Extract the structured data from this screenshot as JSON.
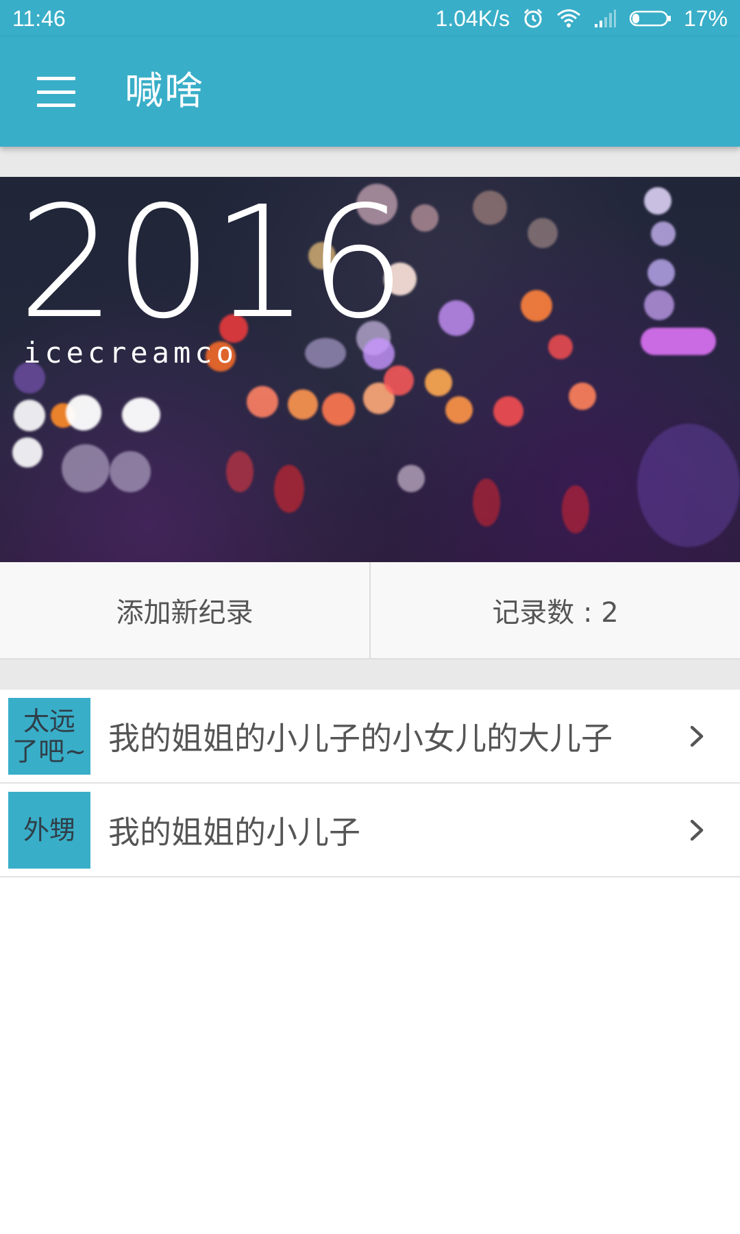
{
  "status_bar": {
    "time": "11:46",
    "net_speed": "1.04K/s",
    "battery": "17%",
    "icons": [
      "alarm-icon",
      "wifi-icon",
      "signal-icon",
      "battery-icon"
    ]
  },
  "app_bar": {
    "title": "喊啥",
    "menu_icon": "hamburger-menu-icon"
  },
  "banner": {
    "year": "2016",
    "subtitle": "icecreamco"
  },
  "actions": {
    "add_label": "添加新纪录",
    "count_label": "记录数 : 2"
  },
  "records": [
    {
      "tag": "太远了吧~",
      "text": "我的姐姐的小儿子的小女儿的大儿子"
    },
    {
      "tag": "外甥",
      "text": "我的姐姐的小儿子"
    }
  ],
  "colors": {
    "primary": "#39aec8",
    "divider": "#e9e9e9",
    "text": "#555555"
  }
}
